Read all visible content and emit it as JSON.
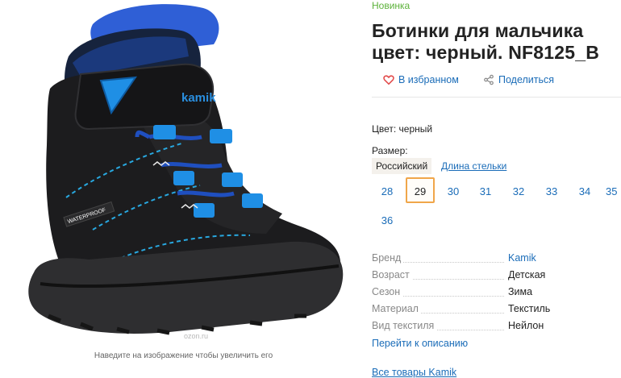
{
  "gallery": {
    "zoom_hint": "Наведите на изображение чтобы увеличить его",
    "watermark": "ozon.ru",
    "boot_brand_text": "kamik",
    "boot_label_text": "WATERPROOF"
  },
  "product": {
    "badge": "Новинка",
    "title_line1": "Ботинки для мальчика",
    "title_line2": "цвет: черный. NF8125_B",
    "favorite_label": "В избранном",
    "share_label": "Поделиться",
    "color_line": "Цвет: черный",
    "size_label": "Размер:",
    "size_tabs": [
      "Российский",
      "Длина стельки"
    ],
    "sizes": [
      "28",
      "29",
      "30",
      "31",
      "32",
      "33",
      "34",
      "35",
      "36"
    ],
    "selected_size": "29"
  },
  "properties": [
    {
      "key": "Бренд",
      "value": "Kamik",
      "link": true
    },
    {
      "key": "Возраст",
      "value": "Детская",
      "link": false
    },
    {
      "key": "Сезон",
      "value": "Зима",
      "link": false
    },
    {
      "key": "Материал",
      "value": "Текстиль",
      "link": false
    },
    {
      "key": "Вид текстиля",
      "value": "Нейлон",
      "link": false
    }
  ],
  "links": {
    "go_description": "Перейти к описанию",
    "all_brand": "Все товары Kamik"
  },
  "colors": {
    "accent_link": "#1a6cb8",
    "badge_new": "#5cb23a",
    "selected_border": "#f0a64a",
    "favorite_heart": "#e24a4a",
    "boot_black": "#1c1c1e",
    "boot_blue": "#1f7fd8"
  }
}
